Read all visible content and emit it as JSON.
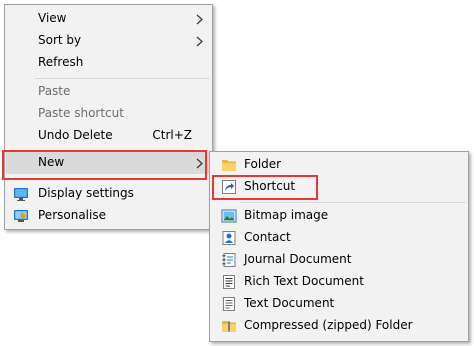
{
  "context_menu": {
    "items": [
      {
        "label": "View",
        "has_submenu": true
      },
      {
        "label": "Sort by",
        "has_submenu": true
      },
      {
        "label": "Refresh"
      },
      {
        "label": "Paste",
        "disabled": true
      },
      {
        "label": "Paste shortcut",
        "disabled": true
      },
      {
        "label": "Undo Delete",
        "shortcut": "Ctrl+Z"
      },
      {
        "label": "New",
        "has_submenu": true,
        "highlighted": true
      },
      {
        "label": "Display settings",
        "icon": "display-settings-icon"
      },
      {
        "label": "Personalise",
        "icon": "personalise-icon"
      }
    ]
  },
  "new_submenu": {
    "items": [
      {
        "label": "Folder",
        "icon": "folder-icon"
      },
      {
        "label": "Shortcut",
        "icon": "shortcut-icon",
        "highlighted": true
      },
      {
        "label": "Bitmap image",
        "icon": "bitmap-image-icon"
      },
      {
        "label": "Contact",
        "icon": "contact-icon"
      },
      {
        "label": "Journal Document",
        "icon": "journal-document-icon"
      },
      {
        "label": "Rich Text Document",
        "icon": "rich-text-document-icon"
      },
      {
        "label": "Text Document",
        "icon": "text-document-icon"
      },
      {
        "label": "Compressed (zipped) Folder",
        "icon": "zipped-folder-icon"
      }
    ]
  },
  "colors": {
    "menu_background": "#f2f2f2",
    "hover_background": "#dadada",
    "highlight_box": "#e53935",
    "disabled_text": "#6d6d6d"
  }
}
